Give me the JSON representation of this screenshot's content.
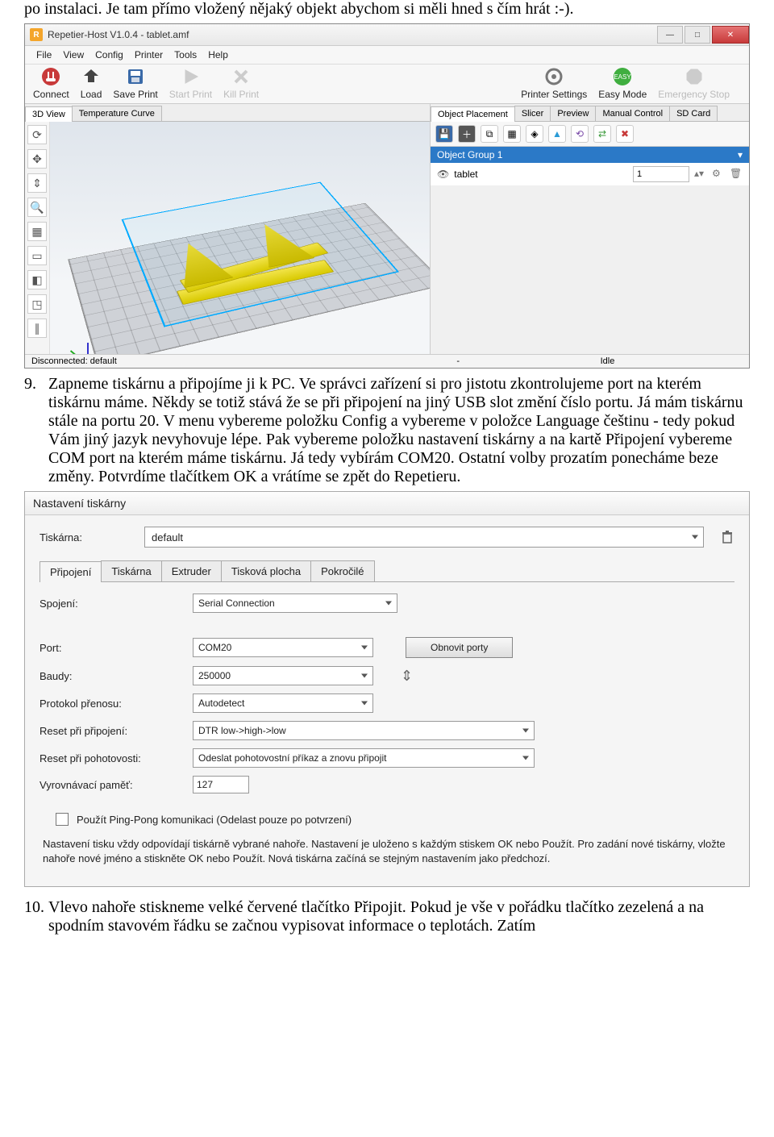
{
  "intro_text": "po instalaci. Je tam přímo vložený nějaký objekt abychom si měli hned s čím hrát :-).",
  "app": {
    "title": "Repetier-Host V1.0.4 - tablet.amf",
    "menus": [
      "File",
      "View",
      "Config",
      "Printer",
      "Tools",
      "Help"
    ],
    "toolbar": {
      "connect": "Connect",
      "load": "Load",
      "save_print": "Save Print",
      "start_print": "Start Print",
      "kill_print": "Kill Print",
      "printer_settings": "Printer Settings",
      "easy_mode": "Easy Mode",
      "emergency": "Emergency Stop"
    },
    "left_tabs": [
      "3D View",
      "Temperature Curve"
    ],
    "right_tabs": [
      "Object Placement",
      "Slicer",
      "Preview",
      "Manual Control",
      "SD Card"
    ],
    "object_group": "Object Group 1",
    "object_name": "tablet",
    "object_count": "1",
    "status_left": "Disconnected: default",
    "status_mid": "-",
    "status_right": "Idle"
  },
  "step9_num": "9.",
  "step9_text": "Zapneme tiskárnu a připojíme ji k PC. Ve správci zařízení si pro jistotu zkontrolujeme port na kterém tiskárnu máme. Někdy se totiž stává že se při připojení na jiný USB slot změní číslo portu. Já mám tiskárnu stále na portu 20. V menu vybereme položku Config a vybereme v položce Language češtinu - tedy pokud Vám jiný jazyk nevyhovuje lépe. Pak vybereme položku nastavení tiskárny a na kartě Připojení vybereme COM port na kterém máme tiskárnu. Já tedy vybírám COM20. Ostatní volby prozatím ponecháme beze změny. Potvrdíme tlačítkem OK a vrátíme se zpět do Repetieru.",
  "dialog": {
    "title": "Nastavení tiskárny",
    "printer_label": "Tiskárna:",
    "printer_value": "default",
    "tabs": [
      "Připojení",
      "Tiskárna",
      "Extruder",
      "Tisková plocha",
      "Pokročilé"
    ],
    "connection_label": "Spojení:",
    "connection_value": "Serial Connection",
    "port_label": "Port:",
    "port_value": "COM20",
    "refresh_ports": "Obnovit porty",
    "baud_label": "Baudy:",
    "baud_value": "250000",
    "proto_label": "Protokol přenosu:",
    "proto_value": "Autodetect",
    "reset_conn_label": "Reset při připojení:",
    "reset_conn_value": "DTR low->high->low",
    "reset_ready_label": "Reset při pohotovosti:",
    "reset_ready_value": "Odeslat pohotovostní příkaz a znovu připojit",
    "buffer_label": "Vyrovnávací paměť:",
    "buffer_value": "127",
    "checkbox_label": "Použít Ping-Pong komunikaci (Odelast pouze po potvrzení)",
    "note": "Nastavení tisku vždy odpovídají tiskárně vybrané nahoře. Nastavení je uloženo s každým stiskem OK nebo Použít. Pro zadání nové tiskárny, vložte nahoře nové jméno a stiskněte OK nebo Použít. Nová tiskárna začíná se stejným nastavením jako předchozí."
  },
  "step10_num": "10.",
  "step10_text": "Vlevo nahoře stiskneme velké červené tlačítko Připojit. Pokud je vše v pořádku tlačítko zezelená a na spodním stavovém řádku se začnou vypisovat informace o teplotách. Zatím"
}
